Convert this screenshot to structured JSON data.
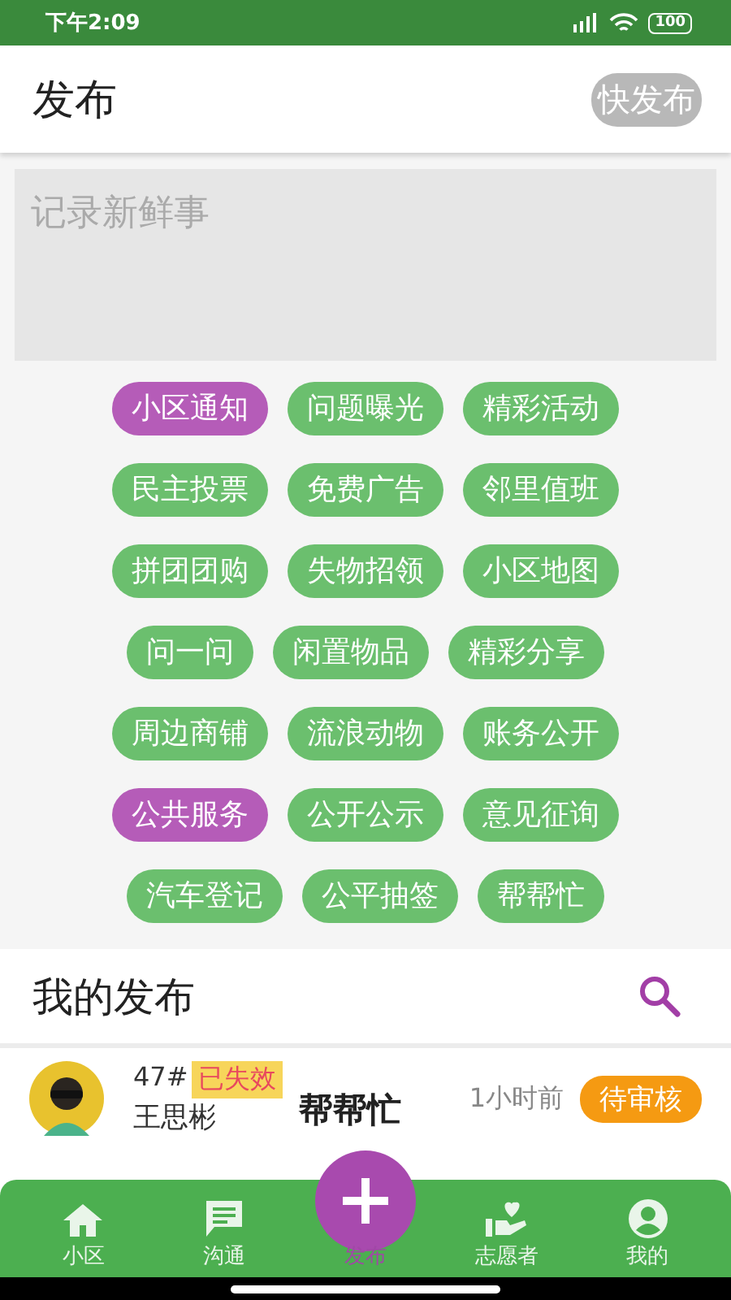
{
  "status_bar": {
    "time": "下午2:09",
    "battery": "100"
  },
  "header": {
    "title": "发布",
    "quick_button": "快发布"
  },
  "composer": {
    "placeholder": "记录新鲜事"
  },
  "tag_rows": [
    [
      {
        "label": "小区通知",
        "selected": true
      },
      {
        "label": "问题曝光",
        "selected": false
      },
      {
        "label": "精彩活动",
        "selected": false
      }
    ],
    [
      {
        "label": "民主投票",
        "selected": false
      },
      {
        "label": "免费广告",
        "selected": false
      },
      {
        "label": "邻里值班",
        "selected": false
      }
    ],
    [
      {
        "label": "拼团团购",
        "selected": false
      },
      {
        "label": "失物招领",
        "selected": false
      },
      {
        "label": "小区地图",
        "selected": false
      }
    ],
    [
      {
        "label": "问一问",
        "selected": false
      },
      {
        "label": "闲置物品",
        "selected": false
      },
      {
        "label": "精彩分享",
        "selected": false
      }
    ],
    [
      {
        "label": "周边商铺",
        "selected": false
      },
      {
        "label": "流浪动物",
        "selected": false
      },
      {
        "label": "账务公开",
        "selected": false
      }
    ],
    [
      {
        "label": "公共服务",
        "selected": true
      },
      {
        "label": "公开公示",
        "selected": false
      },
      {
        "label": "意见征询",
        "selected": false
      }
    ],
    [
      {
        "label": "汽车登记",
        "selected": false
      },
      {
        "label": "公平抽签",
        "selected": false
      },
      {
        "label": "帮帮忙",
        "selected": false
      }
    ]
  ],
  "my_posts": {
    "title": "我的发布",
    "items": [
      {
        "room": "47#",
        "name": "王思彬",
        "badge": "已失效",
        "title": "帮帮忙",
        "time": "1小时前",
        "status": "待审核"
      }
    ]
  },
  "bottom_nav": [
    {
      "kind": "home",
      "label": "小区",
      "selected": false
    },
    {
      "kind": "chat",
      "label": "沟通",
      "selected": false
    },
    {
      "kind": "plus",
      "label": "发布",
      "selected": true
    },
    {
      "kind": "volunteer",
      "label": "志愿者",
      "selected": false
    },
    {
      "kind": "profile",
      "label": "我的",
      "selected": false
    }
  ]
}
